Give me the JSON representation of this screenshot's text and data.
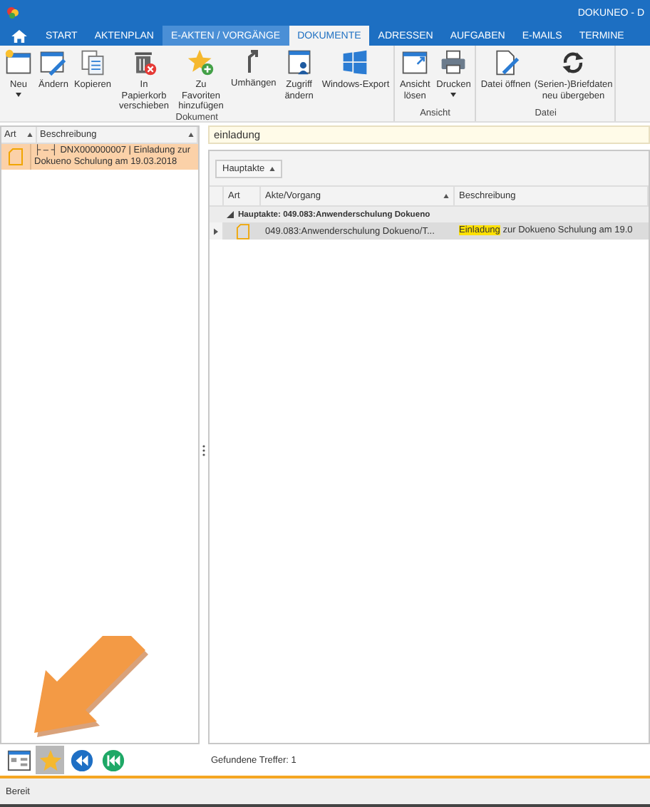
{
  "window": {
    "title": "DOKUNEO - D"
  },
  "tabs": [
    {
      "label": "START",
      "selected": false,
      "highlighted": false
    },
    {
      "label": "AKTENPLAN",
      "selected": false,
      "highlighted": false
    },
    {
      "label": "E-AKTEN / VORGÄNGE",
      "selected": false,
      "highlighted": true
    },
    {
      "label": "DOKUMENTE",
      "selected": true,
      "highlighted": false
    },
    {
      "label": "ADRESSEN",
      "selected": false,
      "highlighted": false
    },
    {
      "label": "AUFGABEN",
      "selected": false,
      "highlighted": false
    },
    {
      "label": "E-MAILS",
      "selected": false,
      "highlighted": false
    },
    {
      "label": "TERMINE",
      "selected": false,
      "highlighted": false
    }
  ],
  "ribbon": [
    {
      "label": "Dokument",
      "buttons": [
        {
          "label": "Neu",
          "dropdown": true
        },
        {
          "label": "Ändern",
          "dropdown": false
        },
        {
          "label": "Kopieren",
          "dropdown": false
        },
        {
          "label": "In Papierkorb verschieben",
          "dropdown": false
        },
        {
          "label": "Zu Favoriten hinzufügen",
          "dropdown": false
        },
        {
          "label": "Umhängen",
          "dropdown": false
        },
        {
          "label": "Zugriff ändern",
          "dropdown": false
        },
        {
          "label": "Windows-Export",
          "dropdown": false
        }
      ]
    },
    {
      "label": "Ansicht",
      "buttons": [
        {
          "label": "Ansicht lösen",
          "dropdown": false
        },
        {
          "label": "Drucken",
          "dropdown": true
        }
      ]
    },
    {
      "label": "Datei",
      "buttons": [
        {
          "label": "Datei öffnen",
          "dropdown": false
        },
        {
          "label": "(Serien-)Briefdaten neu übergeben",
          "dropdown": false
        }
      ]
    }
  ],
  "left_grid": {
    "columns": [
      {
        "label": "Art",
        "sorted": true
      },
      {
        "label": "Beschreibung",
        "sorted": true
      }
    ],
    "rows": [
      {
        "selected": true,
        "description": "├ – ┤ DNX000000007 | Einladung zur Dokueno Schulung am 19.03.2018"
      }
    ]
  },
  "search": {
    "value": "einladung"
  },
  "group_button": {
    "label": "Hauptakte",
    "sorted": true
  },
  "result_grid": {
    "columns": [
      {
        "label": "Art",
        "sorted": false
      },
      {
        "label": "Akte/Vorgang",
        "sorted": true
      },
      {
        "label": "Beschreibung",
        "sorted": false
      }
    ],
    "group": {
      "label": "Hauptakte: 049.083:Anwenderschulung Dokueno",
      "expanded": true
    },
    "rows": [
      {
        "selected": true,
        "akte": "049.083:Anwenderschulung Dokueno/T...",
        "highlight": "Einladung",
        "description": " zur Dokueno Schulung am 19.0"
      }
    ]
  },
  "bottom_toolbar": [
    {
      "kind": "tree",
      "selected": false
    },
    {
      "kind": "star",
      "selected": true
    },
    {
      "kind": "back",
      "selected": false
    },
    {
      "kind": "first",
      "selected": false
    }
  ],
  "result_count": "Gefundene Treffer: 1",
  "status_bar": "Bereit"
}
